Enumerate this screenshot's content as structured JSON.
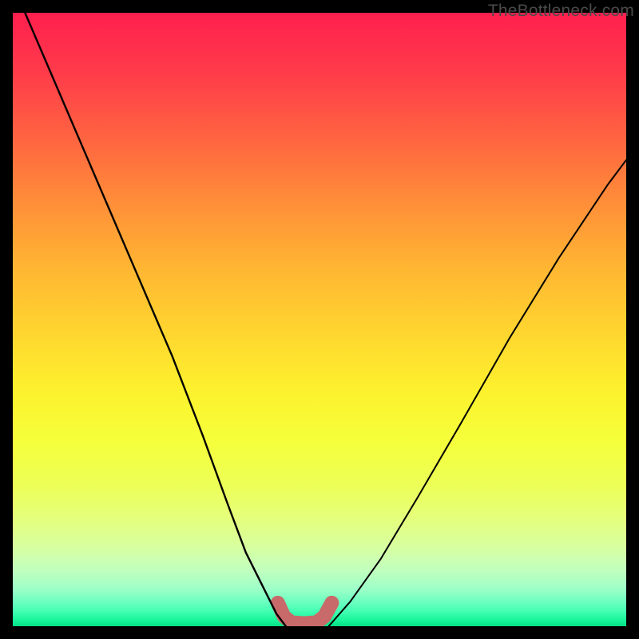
{
  "watermark": "TheBottleneck.com",
  "chart_data": {
    "type": "line",
    "title": "",
    "xlabel": "",
    "ylabel": "",
    "xlim": [
      0,
      100
    ],
    "ylim": [
      0,
      100
    ],
    "grid": false,
    "legend": false,
    "series": [
      {
        "name": "left-curve",
        "x": [
          2,
          8,
          14,
          20,
          26,
          31,
          35,
          38,
          41,
          43,
          44.5
        ],
        "values": [
          100,
          86,
          72,
          58,
          44,
          31,
          20,
          12,
          6,
          2,
          0
        ],
        "color": "#000000",
        "weight": 2.4
      },
      {
        "name": "right-curve",
        "x": [
          51.5,
          55,
          60,
          66,
          73,
          81,
          89,
          97,
          100
        ],
        "values": [
          0,
          4,
          11,
          21,
          33,
          47,
          60,
          72,
          76
        ],
        "color": "#000000",
        "weight": 2.0
      },
      {
        "name": "floor-marker",
        "x": [
          43.2,
          44.2,
          45.4,
          47.5,
          49.5,
          50.8,
          52.0
        ],
        "values": [
          3.8,
          1.6,
          0.6,
          0.45,
          0.6,
          1.6,
          3.8
        ],
        "color": "#c96a6a",
        "weight": 18
      }
    ],
    "background_gradient_note": "vertical red→orange→yellow→green spectrum, approx y=100 green to y=0 red",
    "gradient_stops": [
      {
        "y": 100,
        "color": "#ff1f4e"
      },
      {
        "y": 90,
        "color": "#ff3c4a"
      },
      {
        "y": 78,
        "color": "#ff6a3f"
      },
      {
        "y": 68,
        "color": "#ff9238"
      },
      {
        "y": 58,
        "color": "#ffb732"
      },
      {
        "y": 47,
        "color": "#ffd82f"
      },
      {
        "y": 38,
        "color": "#fdf22e"
      },
      {
        "y": 30,
        "color": "#f5ff3b"
      },
      {
        "y": 23,
        "color": "#ecff57"
      },
      {
        "y": 18,
        "color": "#e6ff79"
      },
      {
        "y": 13,
        "color": "#d8ffa0"
      },
      {
        "y": 9,
        "color": "#c0ffbf"
      },
      {
        "y": 6,
        "color": "#9cffc8"
      },
      {
        "y": 4,
        "color": "#6cffc0"
      },
      {
        "y": 2.5,
        "color": "#45ffb4"
      },
      {
        "y": 1,
        "color": "#18f59a"
      },
      {
        "y": 0,
        "color": "#04de86"
      }
    ]
  }
}
